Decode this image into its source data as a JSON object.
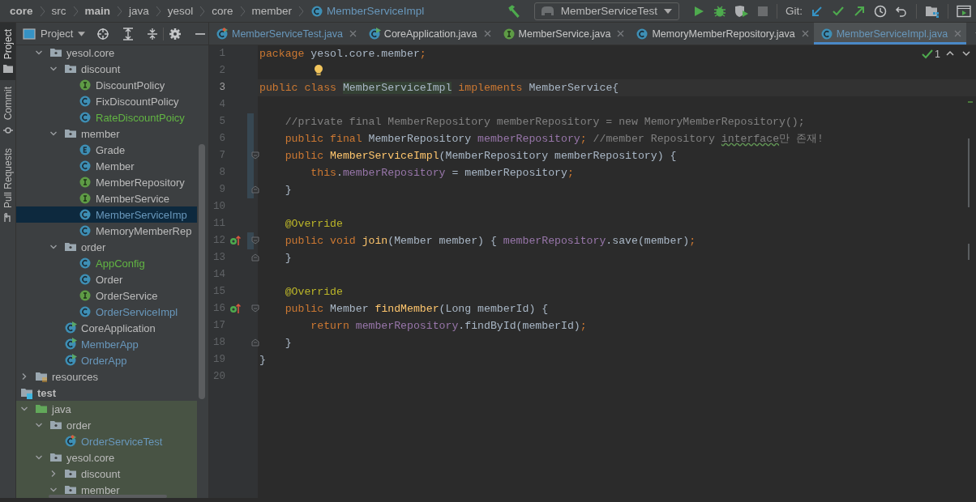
{
  "breadcrumbs": [
    {
      "label": "core",
      "bold": true,
      "kind": "plain",
      "color": "#bbbbbb"
    },
    {
      "label": "src",
      "bold": false,
      "kind": "plain",
      "color": "#bbbbbb"
    },
    {
      "label": "main",
      "bold": true,
      "kind": "plain",
      "color": "#bbbbbb"
    },
    {
      "label": "java",
      "bold": false,
      "kind": "plain",
      "color": "#bbbbbb"
    },
    {
      "label": "yesol",
      "bold": false,
      "kind": "plain",
      "color": "#bbbbbb"
    },
    {
      "label": "core",
      "bold": false,
      "kind": "plain",
      "color": "#bbbbbb"
    },
    {
      "label": "member",
      "bold": false,
      "kind": "plain",
      "color": "#bbbbbb"
    },
    {
      "label": "MemberServiceImpl",
      "bold": false,
      "kind": "class",
      "color": "#6897bb"
    }
  ],
  "toolbar": {
    "run_config": "MemberServiceTest",
    "git_label": "Git:"
  },
  "tool_strip": [
    {
      "label": "Project",
      "selected": true
    },
    {
      "label": "Commit",
      "selected": false
    },
    {
      "label": "Pull Requests",
      "selected": false
    }
  ],
  "project_panel": {
    "title": "Project"
  },
  "project_tree": [
    {
      "children": [
        {
          "children": [
            {
              "label": "yesol.core",
              "kind": "package",
              "expanded": true,
              "selected": false,
              "color": "#bbbbbb",
              "children": [
                {
                  "label": "discount",
                  "kind": "package",
                  "expanded": true,
                  "selected": false,
                  "color": "#bbbbbb",
                  "children": [
                    {
                      "label": "DiscountPolicy",
                      "kind": "interface",
                      "selected": false,
                      "color": "#bbbbbb"
                    },
                    {
                      "label": "FixDiscountPolicy",
                      "kind": "class",
                      "selected": false,
                      "color": "#bbbbbb"
                    },
                    {
                      "label": "RateDiscountPoicy",
                      "kind": "class",
                      "selected": false,
                      "color": "#62b543"
                    }
                  ]
                },
                {
                  "label": "member",
                  "kind": "package",
                  "expanded": true,
                  "selected": false,
                  "color": "#bbbbbb",
                  "children": [
                    {
                      "label": "Grade",
                      "kind": "enum",
                      "selected": false,
                      "color": "#bbbbbb"
                    },
                    {
                      "label": "Member",
                      "kind": "class",
                      "selected": false,
                      "color": "#bbbbbb"
                    },
                    {
                      "label": "MemberRepository",
                      "kind": "interface",
                      "selected": false,
                      "color": "#bbbbbb"
                    },
                    {
                      "label": "MemberService",
                      "kind": "interface",
                      "selected": false,
                      "color": "#bbbbbb"
                    },
                    {
                      "label": "MemberServiceImp",
                      "kind": "class",
                      "selected": true,
                      "color": "#6897bb"
                    },
                    {
                      "label": "MemoryMemberRep",
                      "kind": "class",
                      "selected": false,
                      "color": "#bbbbbb"
                    }
                  ]
                },
                {
                  "label": "order",
                  "kind": "package",
                  "expanded": true,
                  "selected": false,
                  "color": "#bbbbbb",
                  "children": [
                    {
                      "label": "AppConfig",
                      "kind": "class",
                      "selected": false,
                      "color": "#62b543"
                    },
                    {
                      "label": "Order",
                      "kind": "class",
                      "selected": false,
                      "color": "#bbbbbb"
                    },
                    {
                      "label": "OrderService",
                      "kind": "interface",
                      "selected": false,
                      "color": "#bbbbbb"
                    },
                    {
                      "label": "OrderServiceImpl",
                      "kind": "class",
                      "selected": false,
                      "color": "#6897bb"
                    }
                  ]
                },
                {
                  "label": "CoreApplication",
                  "kind": "app",
                  "selected": false,
                  "color": "#bbbbbb"
                },
                {
                  "label": "MemberApp",
                  "kind": "app",
                  "selected": false,
                  "color": "#6897bb"
                },
                {
                  "label": "OrderApp",
                  "kind": "app",
                  "selected": false,
                  "color": "#6897bb"
                }
              ]
            }
          ]
        },
        {
          "label": "resources",
          "kind": "resources",
          "expanded": false,
          "selected": false,
          "color": "#bbbbbb"
        }
      ]
    },
    {
      "label": "test",
      "kind": "test-root",
      "selected": false,
      "color": "#bbbbbb",
      "children": [
        {
          "label": "java",
          "kind": "source-root",
          "expanded": true,
          "selected": false,
          "color": "#bbbbbb",
          "children": [
            {
              "label": "order",
              "kind": "package",
              "expanded": true,
              "selected": false,
              "color": "#bbbbbb",
              "children": [
                {
                  "label": "OrderServiceTest",
                  "kind": "test-class",
                  "selected": false,
                  "color": "#6897bb"
                }
              ]
            },
            {
              "label": "yesol.core",
              "kind": "package",
              "expanded": true,
              "selected": false,
              "color": "#bbbbbb",
              "children": [
                {
                  "label": "discount",
                  "kind": "package",
                  "expanded": false,
                  "selected": false,
                  "color": "#bbbbbb"
                },
                {
                  "label": "member",
                  "kind": "package",
                  "expanded": true,
                  "selected": false,
                  "color": "#bbbbbb"
                }
              ]
            }
          ]
        }
      ]
    }
  ],
  "tabs": [
    {
      "label": "MemberServiceTest.java",
      "kind": "test-class",
      "color": "#6897bb",
      "selected": false
    },
    {
      "label": "CoreApplication.java",
      "kind": "app",
      "color": "#c8c8c8",
      "selected": false
    },
    {
      "label": "MemberService.java",
      "kind": "interface",
      "color": "#c8c8c8",
      "selected": false
    },
    {
      "label": "MemoryMemberRepository.java",
      "kind": "class",
      "color": "#c8c8c8",
      "selected": false
    },
    {
      "label": "MemberServiceImpl.java",
      "kind": "class",
      "color": "#6897bb",
      "selected": true
    }
  ],
  "inspection": {
    "count": "1"
  },
  "code_lines": [
    {
      "number": "1",
      "tokens": [
        {
          "kind": "kw",
          "text": "package"
        },
        {
          "kind": "p",
          "text": " yesol.core.member"
        },
        {
          "kind": "kw",
          "text": ";"
        }
      ],
      "current": false,
      "changed": false,
      "override": false,
      "fold_start": false,
      "fold_end": false,
      "bulb": false
    },
    {
      "number": "2",
      "current": false,
      "changed": false,
      "override": false,
      "fold_start": false,
      "fold_end": false,
      "bulb": true
    },
    {
      "number": "3",
      "tokens": [
        {
          "kind": "kw",
          "text": "public class "
        },
        {
          "kind": "hl",
          "text": "MemberServiceImpl"
        },
        {
          "kind": "kw",
          "text": " implements"
        },
        {
          "kind": "p",
          "text": " MemberService{"
        }
      ],
      "current": true,
      "changed": false,
      "override": false,
      "fold_start": false,
      "fold_end": false,
      "bulb": false
    },
    {
      "number": "4",
      "current": false,
      "changed": false,
      "override": false,
      "fold_start": false,
      "fold_end": false,
      "bulb": false
    },
    {
      "number": "5",
      "tokens": [
        {
          "kind": "comment",
          "text": "    //private final MemberRepository memberRepository = new MemoryMemberRepository();"
        }
      ],
      "current": false,
      "changed": true,
      "override": false,
      "fold_start": false,
      "fold_end": false,
      "bulb": false
    },
    {
      "number": "6",
      "tokens": [
        {
          "kind": "kw",
          "text": "    public final "
        },
        {
          "kind": "p",
          "text": "MemberRepository "
        },
        {
          "kind": "field",
          "text": "memberRepository"
        },
        {
          "kind": "kw",
          "text": ";"
        },
        {
          "kind": "comment",
          "text": " //member Repository "
        },
        {
          "kind": "typo",
          "text": "interface"
        },
        {
          "kind": "comment",
          "text": "만 존재!"
        }
      ],
      "current": false,
      "changed": true,
      "override": false,
      "fold_start": false,
      "fold_end": false,
      "bulb": false
    },
    {
      "number": "7",
      "tokens": [
        {
          "kind": "kw",
          "text": "    public "
        },
        {
          "kind": "method",
          "text": "MemberServiceImpl"
        },
        {
          "kind": "p",
          "text": "(MemberRepository memberRepository) {"
        }
      ],
      "current": false,
      "changed": true,
      "override": false,
      "fold_start": true,
      "fold_end": false,
      "bulb": false
    },
    {
      "number": "8",
      "tokens": [
        {
          "kind": "kw",
          "text": "        this"
        },
        {
          "kind": "p",
          "text": "."
        },
        {
          "kind": "field",
          "text": "memberRepository"
        },
        {
          "kind": "p",
          "text": " = memberRepository"
        },
        {
          "kind": "kw",
          "text": ";"
        }
      ],
      "current": false,
      "changed": true,
      "override": false,
      "fold_start": false,
      "fold_end": false,
      "bulb": false
    },
    {
      "number": "9",
      "tokens": [
        {
          "kind": "p",
          "text": "    }"
        }
      ],
      "current": false,
      "changed": true,
      "override": false,
      "fold_start": false,
      "fold_end": true,
      "bulb": false
    },
    {
      "number": "10",
      "current": false,
      "changed": false,
      "override": false,
      "fold_start": false,
      "fold_end": false,
      "bulb": false
    },
    {
      "number": "11",
      "tokens": [
        {
          "kind": "annot",
          "text": "    @Override"
        }
      ],
      "current": false,
      "changed": false,
      "override": false,
      "fold_start": false,
      "fold_end": false,
      "bulb": false
    },
    {
      "number": "12",
      "tokens": [
        {
          "kind": "kw",
          "text": "    public void "
        },
        {
          "kind": "method",
          "text": "join"
        },
        {
          "kind": "p",
          "text": "(Member member) { "
        },
        {
          "kind": "field",
          "text": "memberRepository"
        },
        {
          "kind": "p",
          "text": ".save(member)"
        },
        {
          "kind": "kw",
          "text": ";"
        }
      ],
      "current": false,
      "changed": true,
      "override": true,
      "fold_start": true,
      "fold_end": false,
      "bulb": false
    },
    {
      "number": "13",
      "tokens": [
        {
          "kind": "p",
          "text": "    }"
        }
      ],
      "current": false,
      "changed": false,
      "override": false,
      "fold_start": false,
      "fold_end": true,
      "bulb": false
    },
    {
      "number": "14",
      "current": false,
      "changed": false,
      "override": false,
      "fold_start": false,
      "fold_end": false,
      "bulb": false
    },
    {
      "number": "15",
      "tokens": [
        {
          "kind": "annot",
          "text": "    @Override"
        }
      ],
      "current": false,
      "changed": false,
      "override": false,
      "fold_start": false,
      "fold_end": false,
      "bulb": false
    },
    {
      "number": "16",
      "tokens": [
        {
          "kind": "kw",
          "text": "    public "
        },
        {
          "kind": "p",
          "text": "Member "
        },
        {
          "kind": "method",
          "text": "findMember"
        },
        {
          "kind": "p",
          "text": "(Long memberId) {"
        }
      ],
      "current": false,
      "changed": false,
      "override": true,
      "fold_start": true,
      "fold_end": false,
      "bulb": false
    },
    {
      "number": "17",
      "tokens": [
        {
          "kind": "kw",
          "text": "        return "
        },
        {
          "kind": "field",
          "text": "memberRepository"
        },
        {
          "kind": "p",
          "text": ".findById(memberId)"
        },
        {
          "kind": "kw",
          "text": ";"
        }
      ],
      "current": false,
      "changed": false,
      "override": false,
      "fold_start": false,
      "fold_end": false,
      "bulb": false
    },
    {
      "number": "18",
      "tokens": [
        {
          "kind": "p",
          "text": "    }"
        }
      ],
      "current": false,
      "changed": false,
      "override": false,
      "fold_start": false,
      "fold_end": true,
      "bulb": false
    },
    {
      "number": "19",
      "tokens": [
        {
          "kind": "p",
          "text": "}"
        }
      ],
      "current": false,
      "changed": false,
      "override": false,
      "fold_start": false,
      "fold_end": false,
      "bulb": false
    },
    {
      "number": "20",
      "current": false,
      "changed": false,
      "override": false,
      "fold_start": false,
      "fold_end": false,
      "bulb": false
    }
  ]
}
